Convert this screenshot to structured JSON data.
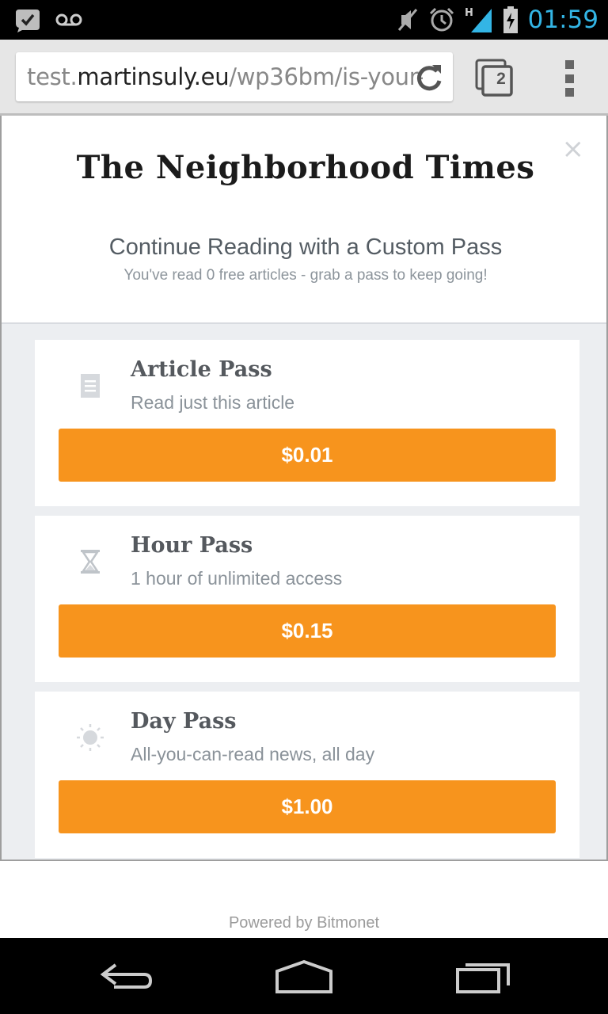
{
  "status_bar": {
    "time": "01:59",
    "icons": [
      "bbm-check-icon",
      "voicemail-icon",
      "mute-icon",
      "alarm-icon",
      "hspa-signal-icon",
      "battery-charging-icon"
    ],
    "clock_color": "#33b5e5"
  },
  "browser": {
    "url_prefix": "test.",
    "url_host": "martinsuly.eu",
    "url_path": "/wp36bm/is-your-",
    "tab_count": "2"
  },
  "modal": {
    "logo": "The Neighborhood Times",
    "close_symbol": "×",
    "headline": "Continue Reading with a Custom Pass",
    "subline": "You've read 0 free articles - grab a pass to keep going!"
  },
  "passes": [
    {
      "title": "Article Pass",
      "description": "Read just this article",
      "price": "$0.01",
      "icon": "document-icon"
    },
    {
      "title": "Hour Pass",
      "description": "1 hour of unlimited access",
      "price": "$0.15",
      "icon": "hourglass-icon"
    },
    {
      "title": "Day Pass",
      "description": "All-you-can-read news, all day",
      "price": "$1.00",
      "icon": "sun-icon"
    }
  ],
  "footer": {
    "powered_by": "Powered by Bitmonet"
  },
  "colors": {
    "accent_orange": "#f7941d",
    "panel_background": "#eceef1"
  },
  "navbar": {
    "buttons": [
      "back-icon",
      "home-icon",
      "recent-apps-icon"
    ]
  }
}
